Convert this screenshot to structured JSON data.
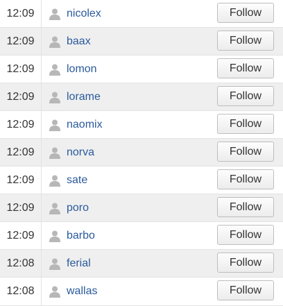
{
  "follow_button_label": "Follow",
  "rows": [
    {
      "time": "12:09",
      "username": "nicolex"
    },
    {
      "time": "12:09",
      "username": "baax"
    },
    {
      "time": "12:09",
      "username": "lomon"
    },
    {
      "time": "12:09",
      "username": "lorame"
    },
    {
      "time": "12:09",
      "username": "naomix"
    },
    {
      "time": "12:09",
      "username": "norva"
    },
    {
      "time": "12:09",
      "username": "sate"
    },
    {
      "time": "12:09",
      "username": "poro"
    },
    {
      "time": "12:09",
      "username": "barbo"
    },
    {
      "time": "12:08",
      "username": "ferial"
    },
    {
      "time": "12:08",
      "username": "wallas"
    }
  ],
  "icons": {
    "avatar": "user-silhouette-icon"
  },
  "colors": {
    "username_link": "#2a5a9c",
    "alt_row_background": "#efefef",
    "border": "#e3e3e3"
  }
}
